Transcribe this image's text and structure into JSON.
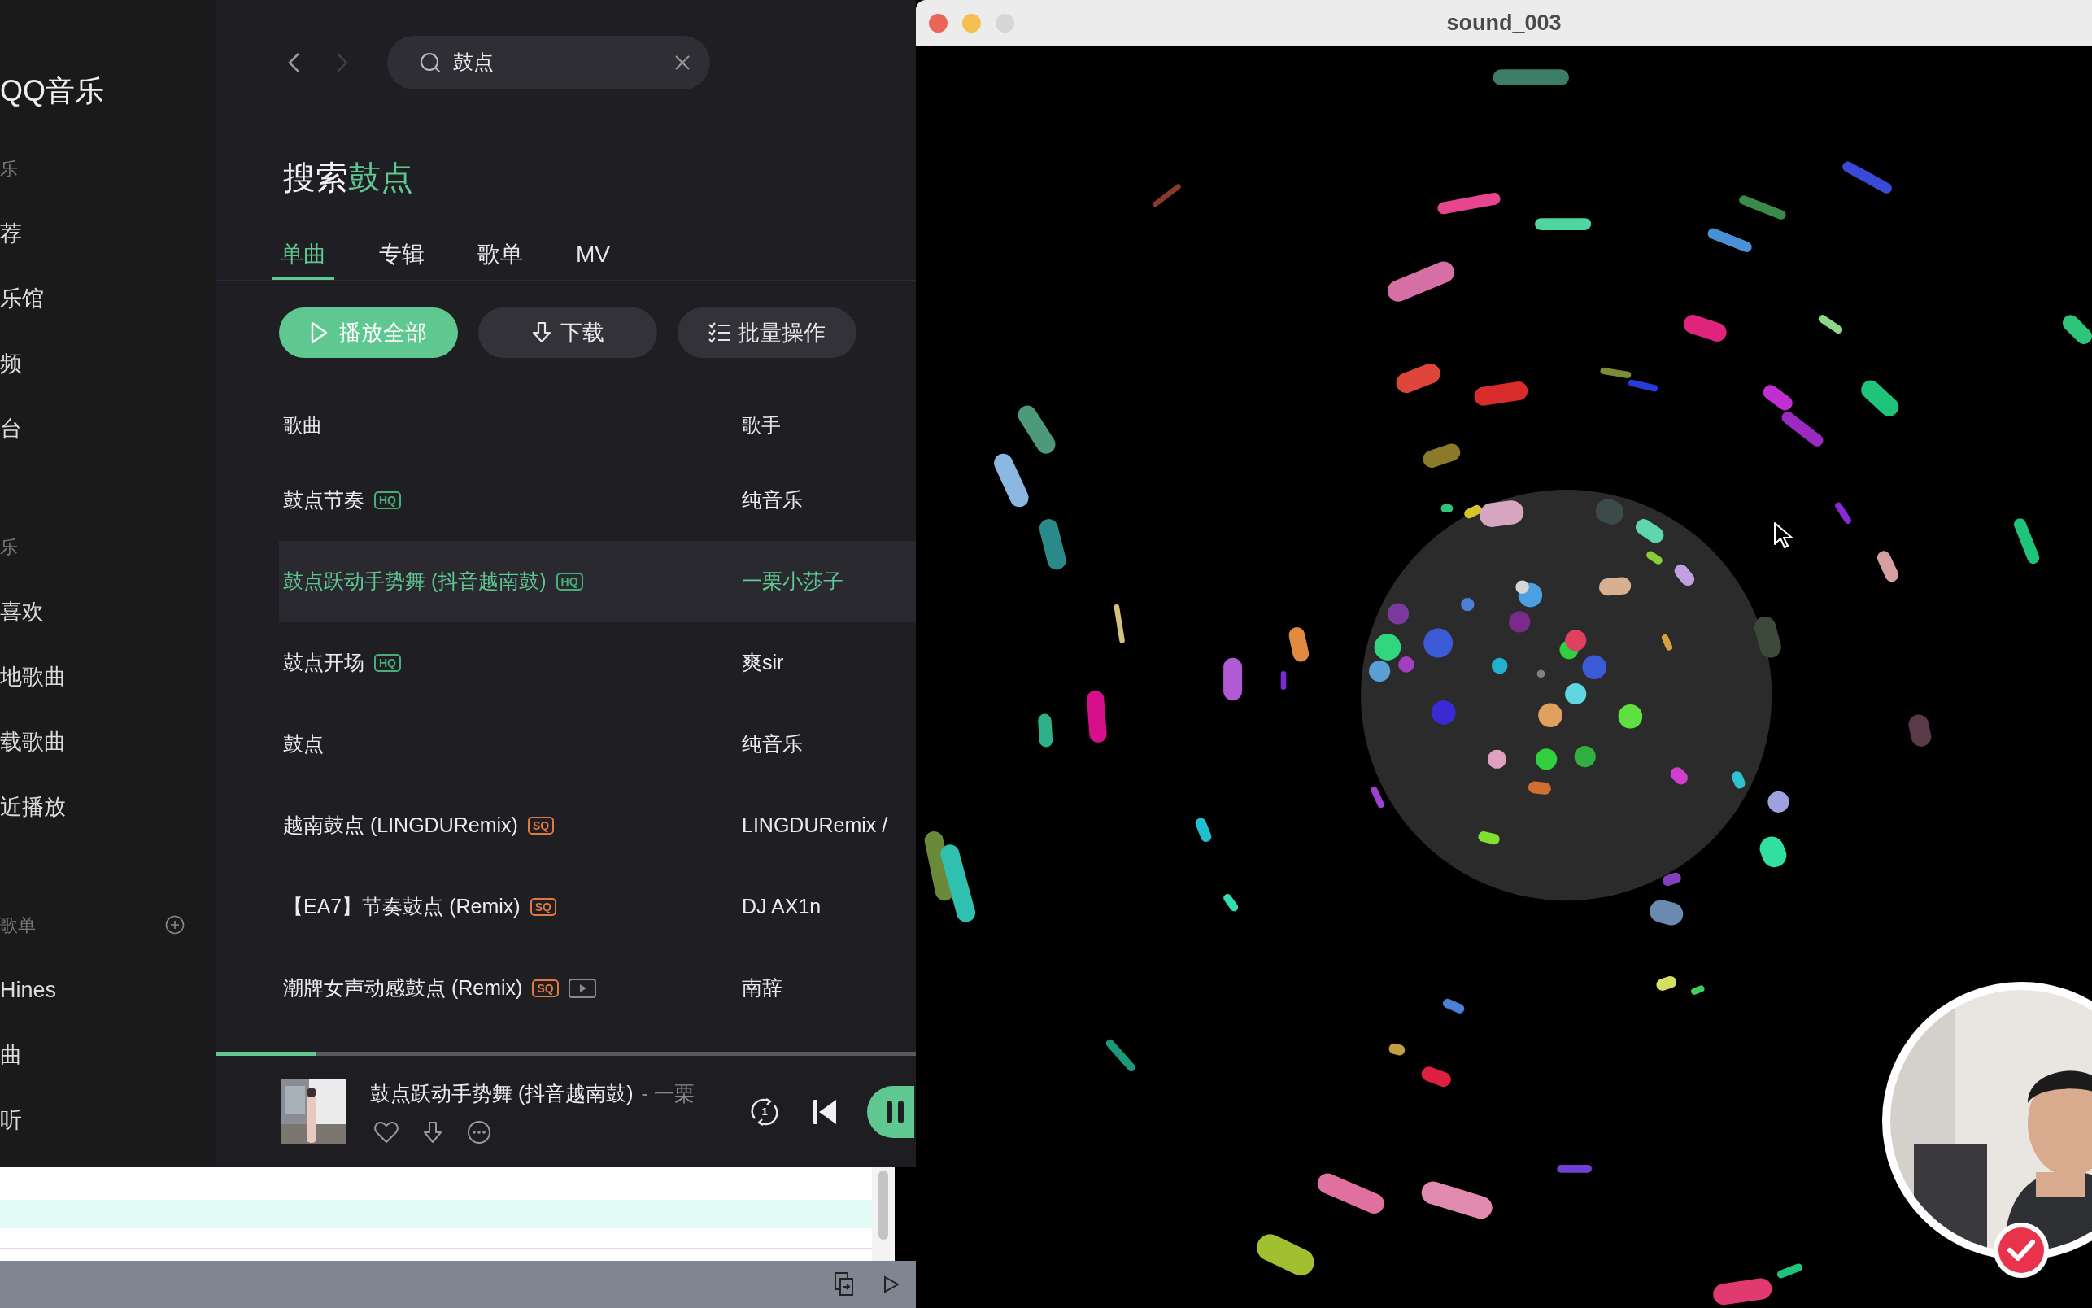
{
  "sidebar": {
    "logo": "QQ音乐",
    "sections": [
      {
        "heading": "乐",
        "items": [
          "荐",
          "乐馆",
          "频",
          "台"
        ]
      },
      {
        "heading": "乐",
        "items": [
          "喜欢",
          "地歌曲",
          "载歌曲",
          "近播放"
        ]
      },
      {
        "heading": "歌单",
        "add_button": true,
        "items": [
          "Hines",
          "曲",
          "听"
        ]
      }
    ]
  },
  "search": {
    "value": "鼓点"
  },
  "title": {
    "prefix": "搜索",
    "query": "鼓点"
  },
  "tabs": [
    {
      "label": "单曲",
      "selected": true
    },
    {
      "label": "专辑",
      "selected": false
    },
    {
      "label": "歌单",
      "selected": false
    },
    {
      "label": "MV",
      "selected": false
    }
  ],
  "actions": [
    {
      "label": "播放全部",
      "kind": "play"
    },
    {
      "label": "下载",
      "kind": "download"
    },
    {
      "label": "批量操作",
      "kind": "batch"
    }
  ],
  "table": {
    "columns": [
      "歌曲",
      "歌手"
    ],
    "rows": [
      {
        "title": "鼓点节奏",
        "badges": [
          {
            "kind": "hq",
            "label": "HQ"
          }
        ],
        "artist": "纯音乐",
        "selected": false
      },
      {
        "title": "鼓点跃动手势舞 (抖音越南鼓)",
        "badges": [
          {
            "kind": "hq",
            "label": "HQ"
          }
        ],
        "artist": "一栗小莎子",
        "selected": true
      },
      {
        "title": "鼓点开场",
        "badges": [
          {
            "kind": "hq",
            "label": "HQ"
          }
        ],
        "artist": "爽sir",
        "selected": false
      },
      {
        "title": "鼓点",
        "badges": [],
        "artist": "纯音乐",
        "selected": false
      },
      {
        "title": "越南鼓点 (LINGDURemix)",
        "badges": [
          {
            "kind": "sq",
            "label": "SQ"
          }
        ],
        "artist": "LINGDURemix /",
        "selected": false
      },
      {
        "title": "【EA7】节奏鼓点 (Remix)",
        "badges": [
          {
            "kind": "sq",
            "label": "SQ"
          }
        ],
        "artist": "DJ AX1n",
        "selected": false
      },
      {
        "title": "潮牌女声动感鼓点 (Remix)",
        "badges": [
          {
            "kind": "sq",
            "label": "SQ"
          },
          {
            "kind": "mv"
          }
        ],
        "artist": "南辞",
        "selected": false
      }
    ]
  },
  "player": {
    "level": 0.143,
    "title": "鼓点跃动手势舞 (抖音越南鼓)",
    "artist": "- 一栗",
    "repeat_label": "1"
  },
  "window": {
    "title": "sound_003"
  }
}
